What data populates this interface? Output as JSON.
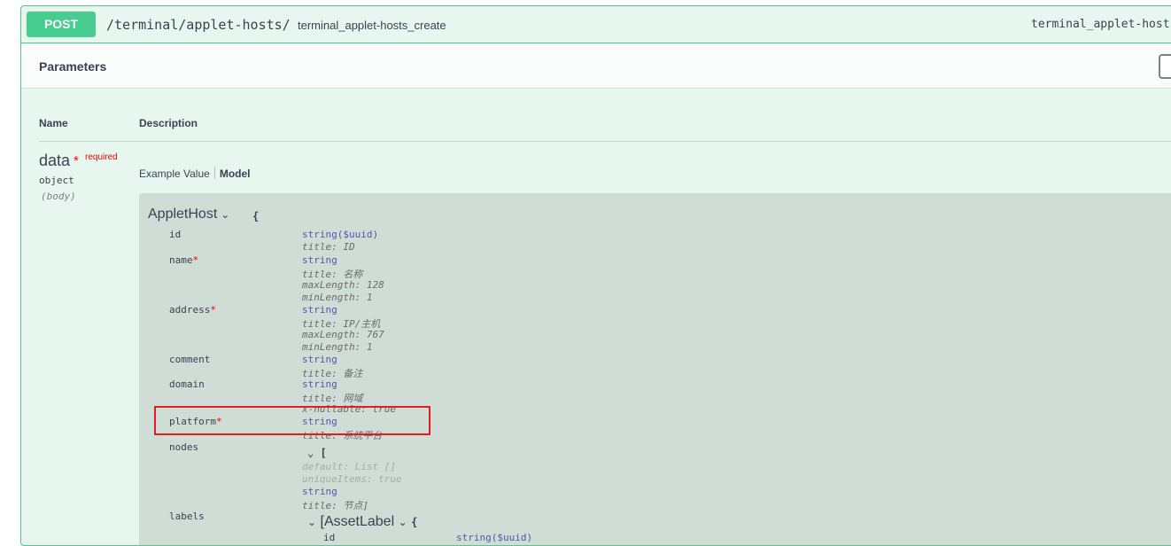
{
  "operation": {
    "method": "POST",
    "path": "/terminal/applet-hosts/",
    "description": "terminal_applet-hosts_create",
    "operation_id": "terminal_applet-hosts_create"
  },
  "parameters": {
    "title": "Parameters",
    "columns": {
      "name": "Name",
      "description": "Description"
    },
    "param": {
      "name": "data",
      "required_star": "*",
      "required_label": "required",
      "type": "object",
      "in": "(body)"
    },
    "tabs": {
      "example": "Example Value",
      "model": "Model"
    }
  },
  "model": {
    "name": "AppletHost",
    "open_brace": "{",
    "props": [
      {
        "key": "id",
        "required": false,
        "type": "string($uuid)",
        "meta": [
          "title: ID"
        ]
      },
      {
        "key": "name",
        "required": true,
        "type": "string",
        "meta": [
          "title: 名称",
          "maxLength: 128",
          "minLength: 1"
        ]
      },
      {
        "key": "address",
        "required": true,
        "type": "string",
        "meta": [
          "title: IP/主机",
          "maxLength: 767",
          "minLength: 1"
        ]
      },
      {
        "key": "comment",
        "required": false,
        "type": "string",
        "meta": [
          "title: 备注"
        ]
      },
      {
        "key": "domain",
        "required": false,
        "type": "string",
        "meta": [
          "title: 网域",
          "x-nullable: true"
        ]
      },
      {
        "key": "platform",
        "required": true,
        "type": "string",
        "meta": [
          "title: 系统平台"
        ]
      },
      {
        "key": "nodes",
        "required": false
      },
      {
        "key": "labels",
        "required": false
      }
    ],
    "nodes_array": {
      "open": "[",
      "default": "default: List []",
      "unique": "uniqueItems: true",
      "item_type": "string",
      "item_title": "title: 节点]"
    },
    "labels_array": {
      "open": "[AssetLabel",
      "brace": "{",
      "first_key": "id",
      "first_type": "string($uuid)"
    }
  },
  "colors": {
    "post": "#49cc90",
    "highlight": "#dd1f1f",
    "required": "#ff0000"
  }
}
